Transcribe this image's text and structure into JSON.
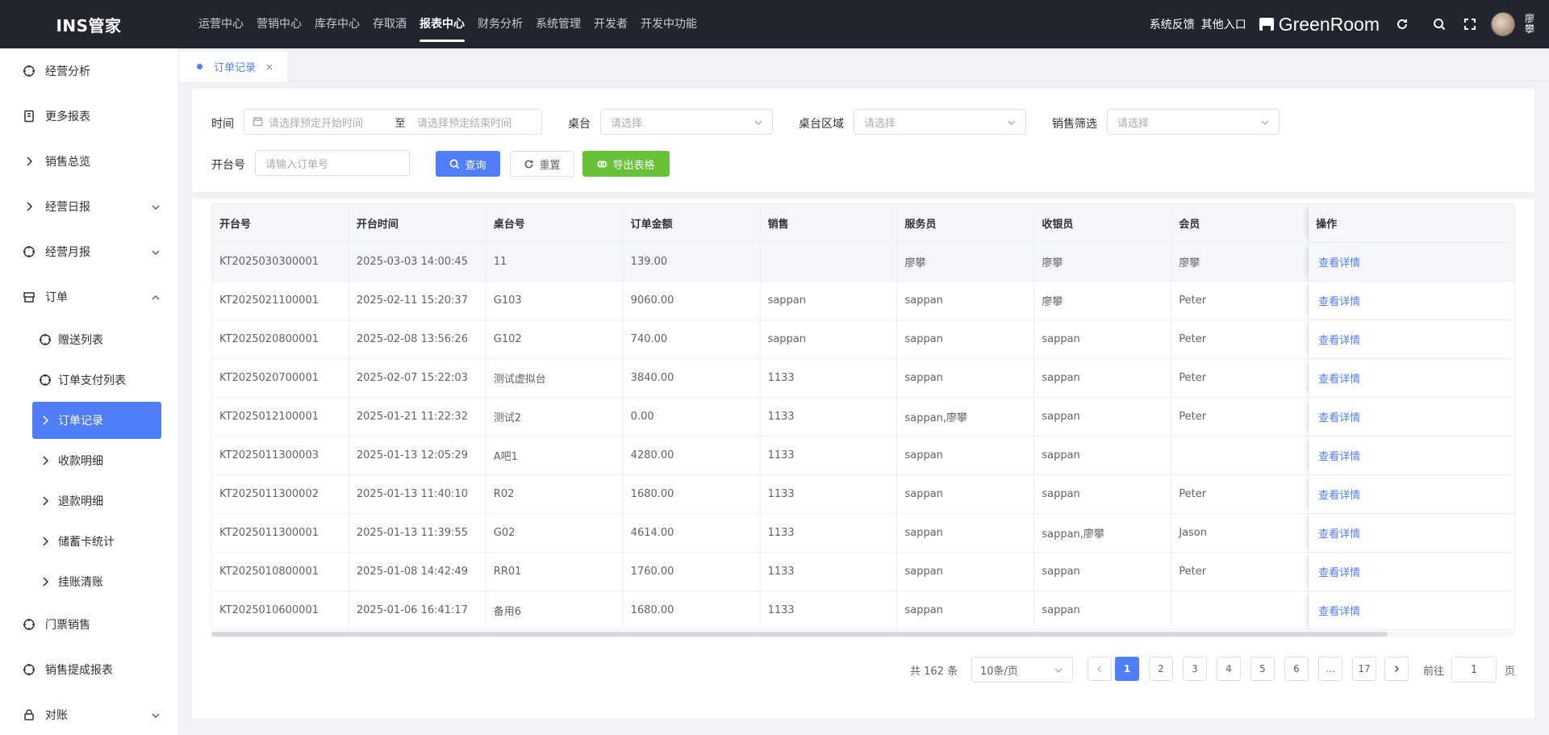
{
  "app": {
    "logo": "INS管家",
    "brand": "GreenRoom",
    "user_name": "廖攀"
  },
  "topnav": {
    "items": [
      "运营中心",
      "营销中心",
      "库存中心",
      "存取酒",
      "报表中心",
      "财务分析",
      "系统管理",
      "开发者",
      "开发中功能"
    ],
    "active_index": 4
  },
  "topright": {
    "feedback": "系统反馈",
    "other_entry": "其他入口"
  },
  "sidebar": {
    "items": [
      {
        "label": "经营分析",
        "icon": "target-icon"
      },
      {
        "label": "更多报表",
        "icon": "book-icon"
      },
      {
        "label": "销售总览",
        "icon": "chevron-right-icon"
      },
      {
        "label": "经营日报",
        "icon": "chevron-right-icon",
        "caret": "down"
      },
      {
        "label": "经营月报",
        "icon": "target-icon",
        "caret": "down"
      },
      {
        "label": "订单",
        "icon": "shop-icon",
        "caret": "up"
      }
    ],
    "sub_items": [
      {
        "label": "赠送列表",
        "icon": "target-icon"
      },
      {
        "label": "订单支付列表",
        "icon": "target-icon"
      },
      {
        "label": "订单记录",
        "icon": "chevron-right-icon",
        "active": true
      },
      {
        "label": "收款明细",
        "icon": "chevron-right-icon"
      },
      {
        "label": "退款明细",
        "icon": "chevron-right-icon"
      },
      {
        "label": "储蓄卡统计",
        "icon": "chevron-right-icon"
      },
      {
        "label": "挂账清账",
        "icon": "chevron-right-icon"
      }
    ],
    "bottom_items": [
      {
        "label": "门票销售",
        "icon": "target-icon"
      },
      {
        "label": "销售提成报表",
        "icon": "target-icon"
      },
      {
        "label": "对账",
        "icon": "lock-icon",
        "caret": "down"
      }
    ]
  },
  "tabs": [
    {
      "label": "订单记录",
      "close": "×"
    }
  ],
  "filters": {
    "time_label": "时间",
    "start_placeholder": "请选择预定开始时间",
    "range_sep": "至",
    "end_placeholder": "请选择预定结束时间",
    "table_label": "桌台",
    "table_placeholder": "请选择",
    "area_label": "桌台区域",
    "area_placeholder": "请选择",
    "sales_label": "销售筛选",
    "sales_placeholder": "请选择",
    "order_no_label": "开台号",
    "order_no_placeholder": "请输入订单号",
    "search_btn": "查询",
    "reset_btn": "重置",
    "export_btn": "导出表格"
  },
  "table": {
    "columns": [
      "开台号",
      "开台时间",
      "桌台号",
      "订单金额",
      "销售",
      "服务员",
      "收银员",
      "会员",
      "操作"
    ],
    "action_label": "查看详情",
    "rows": [
      [
        "KT2025030300001",
        "2025-03-03 14:00:45",
        "11",
        "139.00",
        "",
        "廖攀",
        "廖攀",
        "廖攀"
      ],
      [
        "KT2025021100001",
        "2025-02-11 15:20:37",
        "G103",
        "9060.00",
        "sappan",
        "sappan",
        "廖攀",
        "Peter"
      ],
      [
        "KT2025020800001",
        "2025-02-08 13:56:26",
        "G102",
        "740.00",
        "sappan",
        "sappan",
        "sappan",
        "Peter"
      ],
      [
        "KT2025020700001",
        "2025-02-07 15:22:03",
        "测试虚拟台",
        "3840.00",
        "1133",
        "sappan",
        "sappan",
        "Peter"
      ],
      [
        "KT2025012100001",
        "2025-01-21 11:22:32",
        "测试2",
        "0.00",
        "1133",
        "sappan,廖攀",
        "sappan",
        "Peter"
      ],
      [
        "KT2025011300003",
        "2025-01-13 12:05:29",
        "A吧1",
        "4280.00",
        "1133",
        "sappan",
        "sappan",
        ""
      ],
      [
        "KT2025011300002",
        "2025-01-13 11:40:10",
        "R02",
        "1680.00",
        "1133",
        "sappan",
        "sappan",
        "Peter"
      ],
      [
        "KT2025011300001",
        "2025-01-13 11:39:55",
        "G02",
        "4614.00",
        "1133",
        "sappan",
        "sappan,廖攀",
        "Jason"
      ],
      [
        "KT2025010800001",
        "2025-01-08 14:42:49",
        "RR01",
        "1760.00",
        "1133",
        "sappan",
        "sappan",
        "Peter"
      ],
      [
        "KT2025010600001",
        "2025-01-06 16:41:17",
        "备用6",
        "1680.00",
        "1133",
        "sappan",
        "sappan",
        ""
      ]
    ]
  },
  "pagination": {
    "total_text": "共 162 条",
    "page_size": "10条/页",
    "pages": [
      "1",
      "2",
      "3",
      "4",
      "5",
      "6",
      "…",
      "17"
    ],
    "current": "1",
    "goto_label": "前往",
    "goto_value": "1",
    "page_suffix": "页"
  },
  "colors": {
    "primary": "#4f7ef8",
    "success": "#67c23a",
    "topbar": "#22242e"
  }
}
